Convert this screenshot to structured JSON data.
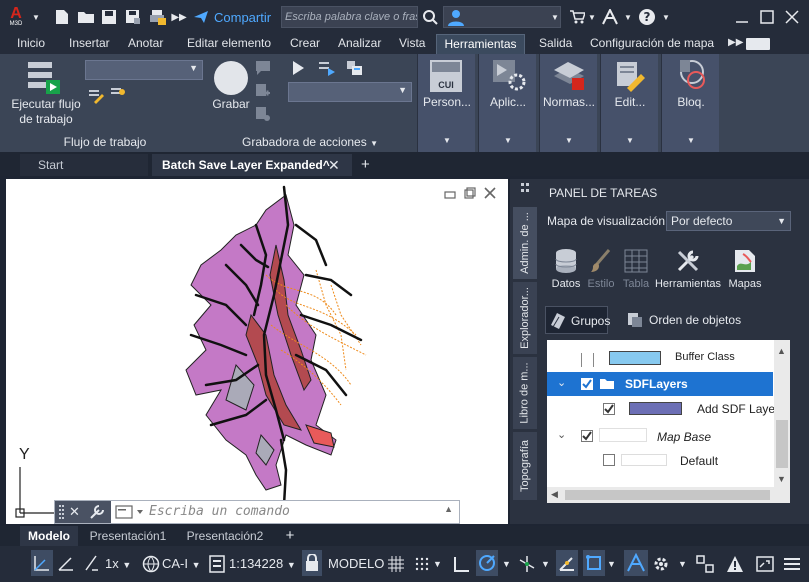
{
  "app": {
    "logo": "M3D",
    "logo_color": "#d5261c"
  },
  "titlebar": {
    "share_label": "Compartir",
    "search_placeholder": "Escriba palabra clave o frase"
  },
  "menu": {
    "tabs": [
      "Inicio",
      "Insertar",
      "Anotar",
      "Editar elemento",
      "Crear",
      "Analizar",
      "Vista",
      "Herramientas",
      "Salida",
      "Configuración de mapa"
    ],
    "active": "Herramientas"
  },
  "ribbon": {
    "workflow": {
      "run_label_1": "Ejecutar flujo",
      "run_label_2": "de trabajo",
      "panel_label": "Flujo de trabajo"
    },
    "recorder": {
      "record_label": "Grabar",
      "panel_label": "Grabadora de acciones"
    },
    "panels": [
      "Person...",
      "Aplic...",
      "Normas...",
      "Edit...",
      "Bloq."
    ],
    "cui_badge": "CUI"
  },
  "doc_tabs": {
    "start": "Start",
    "active": "Batch Save Layer Expanded^"
  },
  "task_panel": {
    "title": "PANEL DE TAREAS",
    "vtabs": [
      "Admin. de ...",
      "Explorador...",
      "Libro de m...",
      "Topografía"
    ],
    "map_label": "Mapa de visualización:",
    "map_value": "Por defecto",
    "tools": [
      "Datos",
      "Estilo",
      "Tabla",
      "Herramientas",
      "Mapas"
    ],
    "groups_label": "Grupos",
    "order_label": "Orden de objetos",
    "layers": {
      "buffer": "Buffer Class",
      "sdf": "SDFLayers",
      "add_sdf": "Add SDF Layer",
      "map_base": "Map Base",
      "default": "Default"
    },
    "highlight_color": "#1e73d1"
  },
  "command": {
    "placeholder": "Escriba un comando"
  },
  "axis": {
    "y_label": "Y"
  },
  "layout_tabs": [
    "Modelo",
    "Presentación1",
    "Presentación2"
  ],
  "status": {
    "scale_factor": "1x",
    "coord_system": "CA-I",
    "scale": "1:134228",
    "model": "MODELO"
  }
}
